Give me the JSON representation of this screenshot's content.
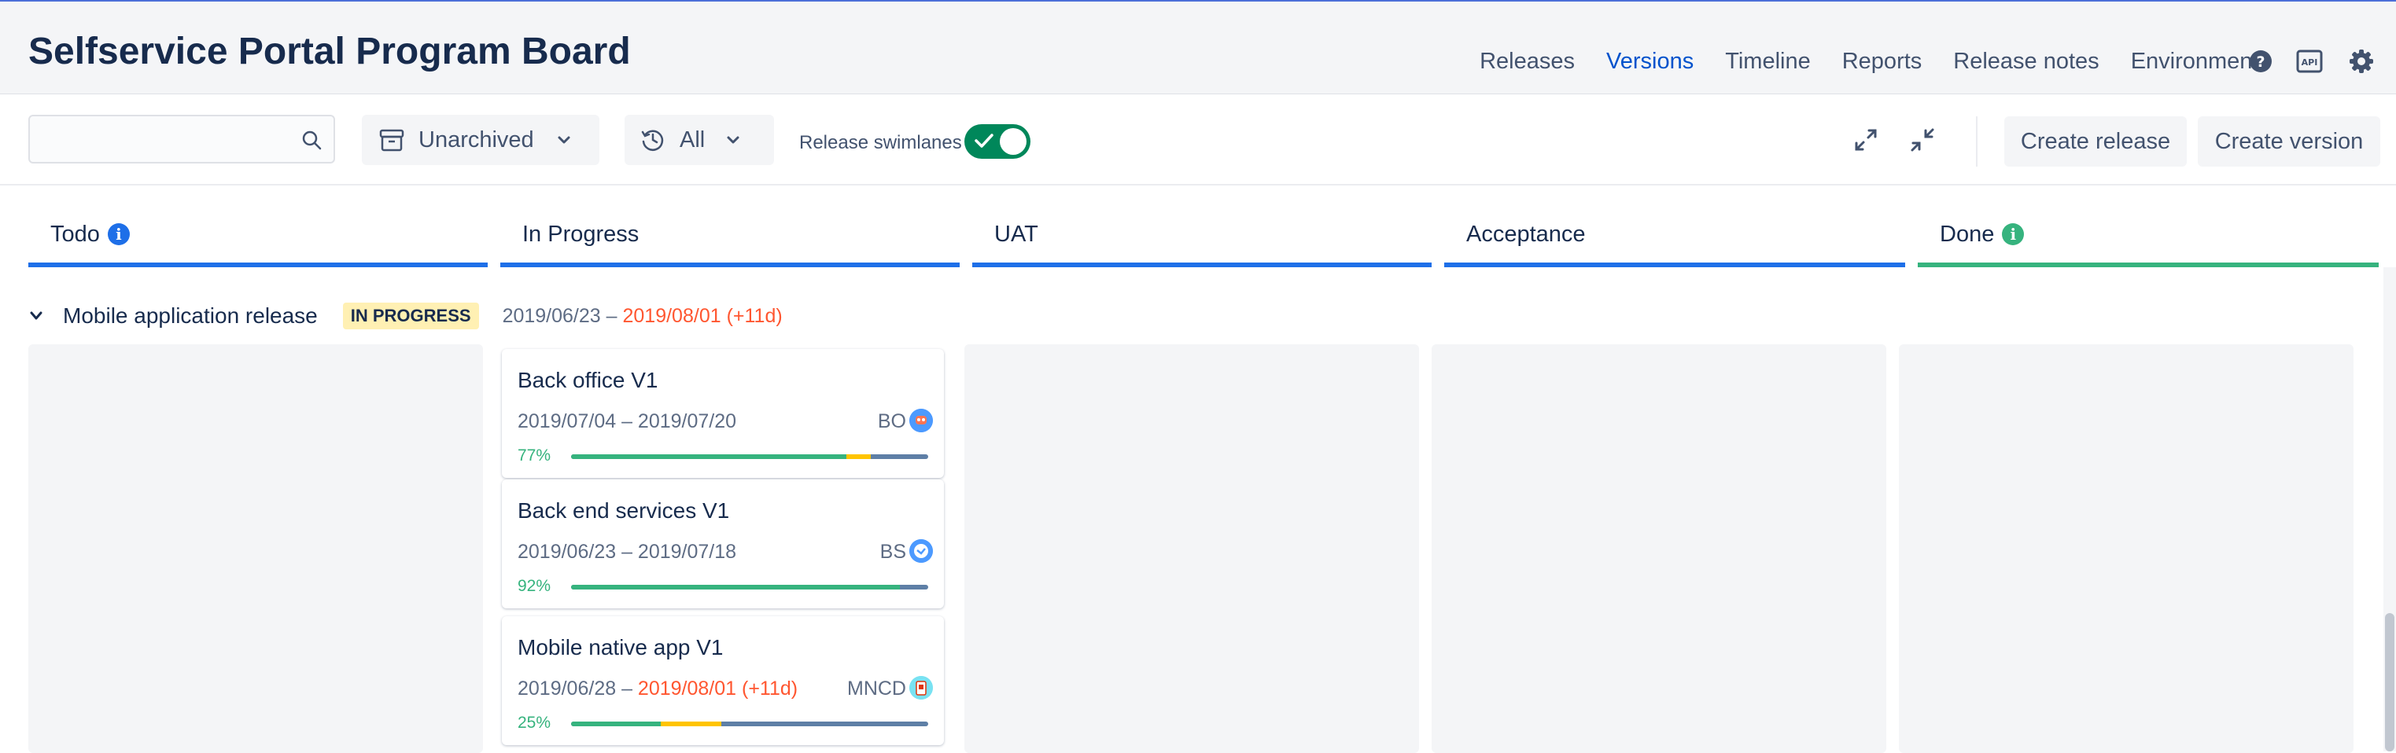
{
  "header": {
    "title": "Selfservice Portal Program Board",
    "nav": [
      {
        "label": "Releases",
        "active": false
      },
      {
        "label": "Versions",
        "active": true
      },
      {
        "label": "Timeline",
        "active": false
      },
      {
        "label": "Reports",
        "active": false
      },
      {
        "label": "Release notes",
        "active": false
      },
      {
        "label": "Environments",
        "active": false
      }
    ],
    "icons": [
      "help-icon",
      "api-icon",
      "settings-gear-icon"
    ]
  },
  "toolbar": {
    "search_value": "",
    "archive_filter": "Unarchived",
    "time_filter": "All",
    "swimlanes_label": "Release swimlanes",
    "swimlanes_on": true,
    "create_release_label": "Create release",
    "create_version_label": "Create version"
  },
  "columns": [
    {
      "label": "Todo",
      "info": true,
      "color": "#1e6fe8"
    },
    {
      "label": "In Progress",
      "info": false,
      "color": "#1e6fe8"
    },
    {
      "label": "UAT",
      "info": false,
      "color": "#1e6fe8"
    },
    {
      "label": "Acceptance",
      "info": false,
      "color": "#1e6fe8"
    },
    {
      "label": "Done",
      "info": true,
      "color": "#36b37e"
    }
  ],
  "swimlane": {
    "title": "Mobile application release",
    "status": "IN PROGRESS",
    "start": "2019/06/23",
    "separator": "–",
    "end": "2019/08/01 (+11d)"
  },
  "cards": [
    {
      "name": "Back office V1",
      "start": "2019/07/04",
      "end": "2019/07/20",
      "end_late": false,
      "code": "BO",
      "progress": "77%",
      "bar": {
        "green": 0.77,
        "yellow": 0.07
      }
    },
    {
      "name": "Back end services V1",
      "start": "2019/06/23",
      "end": "2019/07/18",
      "end_late": false,
      "code": "BS",
      "progress": "92%",
      "bar": {
        "green": 0.92,
        "yellow": 0.0
      }
    },
    {
      "name": "Mobile native app V1",
      "start": "2019/06/28",
      "end": "2019/08/01 (+11d)",
      "end_late": true,
      "code": "MNCD",
      "progress": "25%",
      "bar": {
        "green": 0.25,
        "yellow": 0.17
      }
    }
  ],
  "colors": {
    "accent": "#0052cc",
    "toggle_on": "#00875a",
    "late": "#ff5630",
    "progress_text": "#36b37e",
    "lozenge_bg": "#fff0b3"
  }
}
